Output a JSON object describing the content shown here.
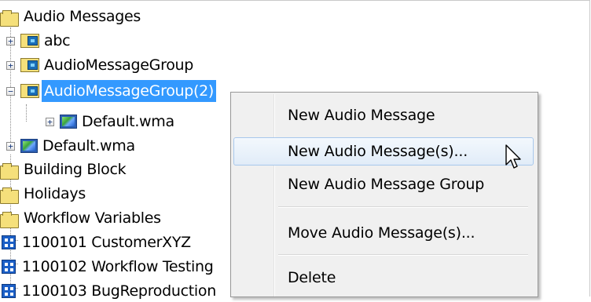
{
  "tree": {
    "root": {
      "label": "Audio Messages"
    },
    "groups": [
      {
        "label": "abc",
        "expander": "+"
      },
      {
        "label": "AudioMessageGroup",
        "expander": "+"
      },
      {
        "label": "AudioMessageGroup(2)",
        "expander": "−",
        "selected": true,
        "children": [
          {
            "label": "Default.wma",
            "expander": "+"
          }
        ]
      }
    ],
    "root_files": [
      {
        "label": "Default.wma",
        "expander": "+"
      }
    ],
    "folders": [
      {
        "label": "Building Block"
      },
      {
        "label": "Holidays"
      },
      {
        "label": "Workflow Variables"
      }
    ],
    "workflows": [
      {
        "label": "1100101 CustomerXYZ"
      },
      {
        "label": "1100102 Workflow Testing"
      },
      {
        "label": "1100103 BugReproduction"
      }
    ]
  },
  "context_menu": {
    "items": [
      {
        "label": "New Audio Message"
      },
      {
        "label": "New Audio Message(s)...",
        "hover": true
      },
      {
        "label": "New Audio Message Group"
      },
      {
        "label": "Move Audio Message(s)..."
      },
      {
        "label": "Delete"
      }
    ]
  },
  "colors": {
    "selection": "#3399ff",
    "menu_background": "#f0f0f0",
    "menu_hover_border": "#a8c8ec",
    "folder": "#f5e07b"
  }
}
